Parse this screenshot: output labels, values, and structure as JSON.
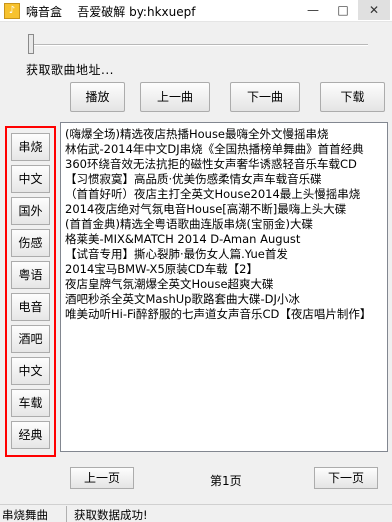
{
  "window": {
    "title": "嗨音盒    吾爱破解 by:hkxuepf",
    "min_glyph": "—",
    "max_glyph": "□",
    "close_glyph": "✕"
  },
  "player": {
    "progress": 0,
    "status": "获取歌曲地址..."
  },
  "controls": {
    "play": "播放",
    "prev": "上一曲",
    "next": "下一曲",
    "download": "下载"
  },
  "categories": [
    "串烧",
    "中文",
    "国外",
    "伤感",
    "粤语",
    "电音",
    "酒吧",
    "中文",
    "车载",
    "经典"
  ],
  "songs": [
    "(嗨爆全场)精选夜店热播House最嗨全外文慢摇串烧",
    "林佑武-2014年中文DJ串烧《全国热播榜单舞曲》首首经典",
    "360环绕音效无法抗拒的磁性女声奢华诱惑轻音乐车载CD",
    "【习惯寂寞】高品质·优美伤感柔情女声车载音乐碟",
    "（首首好听）夜店主打全英文House2014最上头慢摇串烧",
    "2014夜店绝对气氛电音House[高潮不断]最嗨上头大碟",
    "(首首金典)精选全粤语歌曲连版串烧(宝丽金)大碟",
    "格莱美-MIX&MATCH 2014 D-Aman August",
    "【试音专用】撕心裂肺·最伤女人篇.Yue首发",
    "2014宝马BMW-X5原装CD车载【2】",
    "夜店皇牌气氛潮爆全英文House超爽大碟",
    "酒吧秒杀全英文MashUp歌路套曲大碟-DJ小冰",
    "唯美动听Hi-Fi醉舒服的七声道女声音乐CD【夜店唱片制作】"
  ],
  "pagination": {
    "prev": "上一页",
    "page": "第1页",
    "next": "下一页"
  },
  "statusbar": {
    "left": "串烧舞曲",
    "right": "获取数据成功!"
  }
}
